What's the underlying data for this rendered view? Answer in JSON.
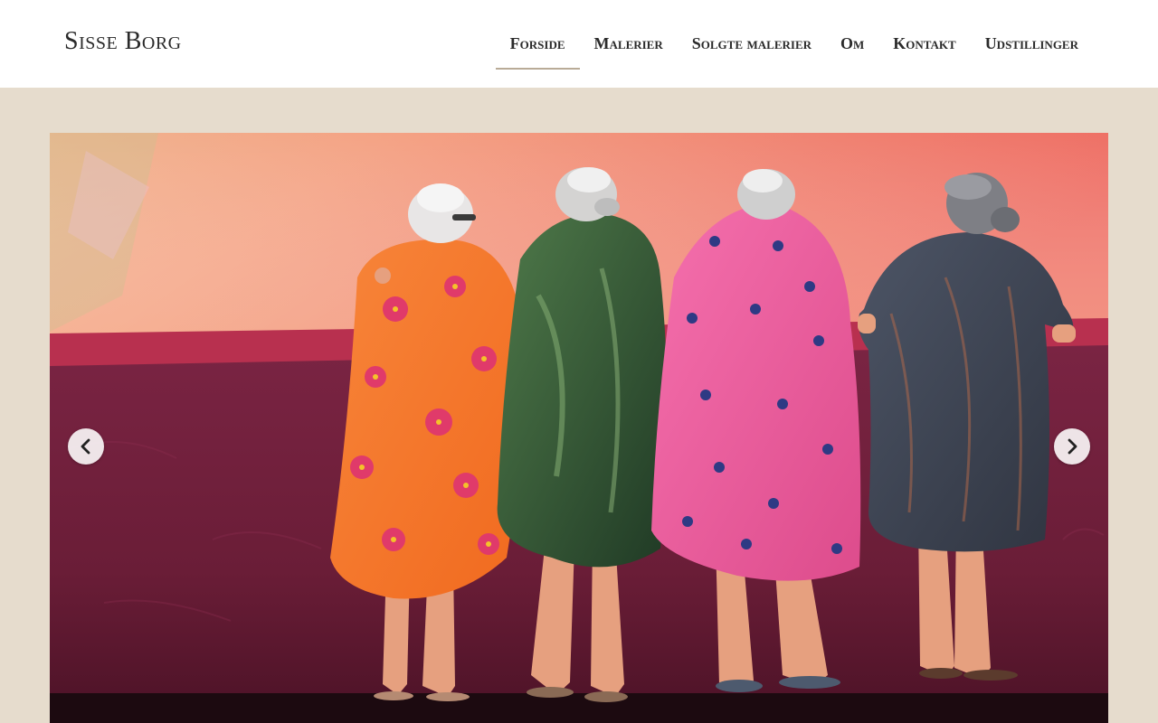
{
  "site": {
    "brand": "Sisse Borg"
  },
  "nav": {
    "items": [
      {
        "label": "Forside",
        "active": true
      },
      {
        "label": "Malerier"
      },
      {
        "label": "Solgte malerier"
      },
      {
        "label": "Om"
      },
      {
        "label": "Kontakt"
      },
      {
        "label": "Udstillinger"
      }
    ]
  },
  "slider": {
    "prev_icon": "chevron-left-icon",
    "next_icon": "chevron-right-icon"
  },
  "colors": {
    "header_bg": "#ffffff",
    "page_bg": "#e6dccd",
    "active_underline": "#b9ab97"
  }
}
